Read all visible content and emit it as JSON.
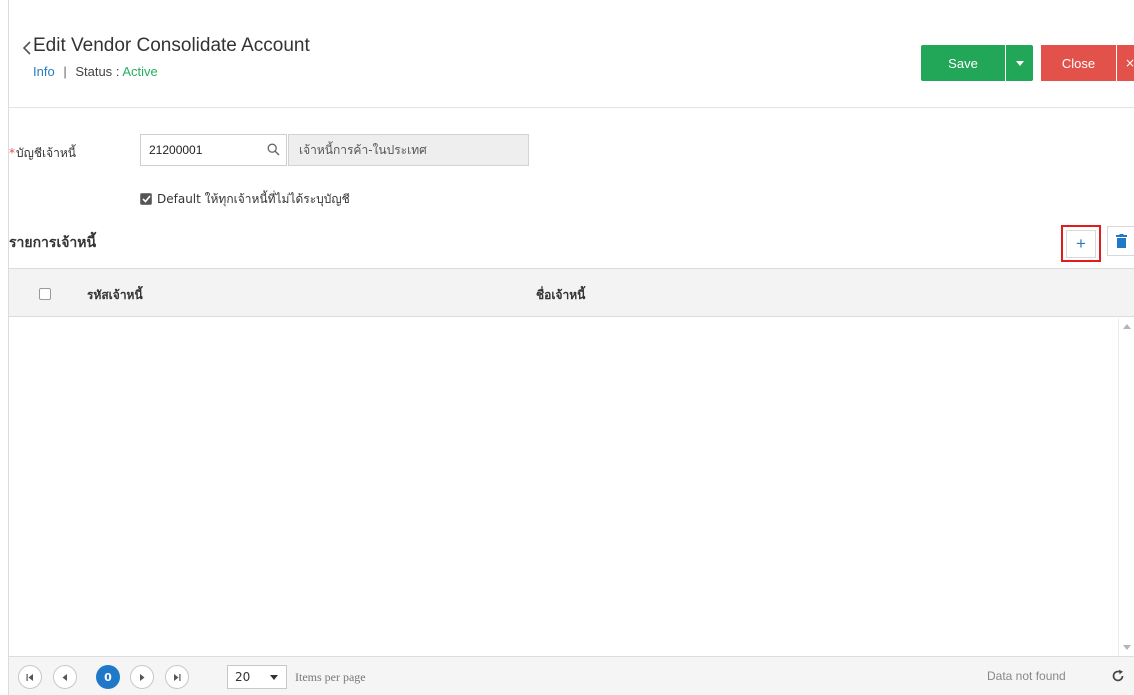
{
  "header": {
    "title": "Edit Vendor Consolidate Account",
    "info_link": "Info",
    "separator": "|",
    "status_label": "Status",
    "status_colon": ":",
    "status_value": "Active",
    "save_label": "Save",
    "close_label": "Close",
    "close_x": "×"
  },
  "form": {
    "required_mark": "*",
    "account_label": "บัญชีเจ้าหนี้",
    "account_code": "21200001",
    "account_name": "เจ้าหนี้การค้า-ในประเทศ",
    "default_checked": true,
    "default_label": "Default ให้ทุกเจ้าหนี้ที่ไม่ได้ระบุบัญชี"
  },
  "section": {
    "title": "รายการเจ้าหนี้",
    "add_label": "+"
  },
  "grid": {
    "columns": [
      "รหัสเจ้าหนี้",
      "ชื่อเจ้าหนี้"
    ],
    "rows": []
  },
  "pager": {
    "current_page": "0",
    "page_size": "20",
    "items_per_page_label": "Items per page",
    "status": "Data not found"
  },
  "colors": {
    "save": "#22a657",
    "close": "#e3524a",
    "link": "#2b7bbf",
    "status_active": "#27ae60",
    "highlight": "#e01d1d",
    "pager_active": "#1f78c8"
  },
  "icons": {
    "back": "chevron-left-icon",
    "dropdown": "caret-down-icon",
    "search": "search-icon",
    "trash": "trash-icon",
    "refresh": "refresh-icon",
    "first": "first-page-icon",
    "prev": "prev-page-icon",
    "next": "next-page-icon",
    "last": "last-page-icon"
  }
}
